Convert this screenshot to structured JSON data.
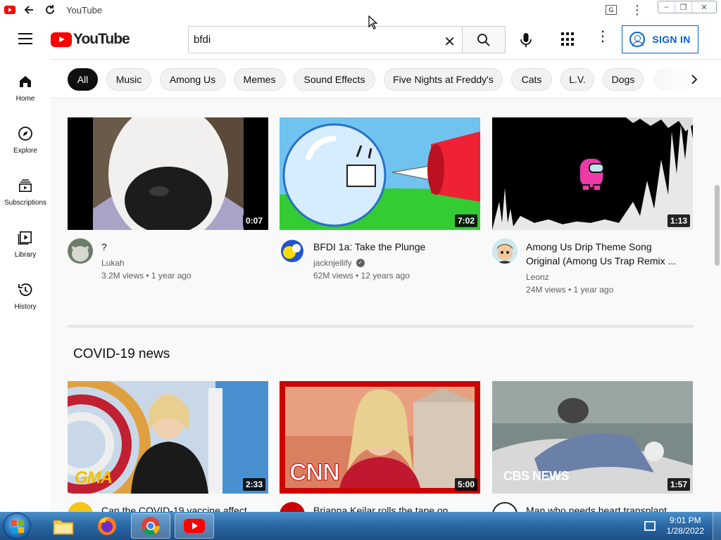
{
  "window": {
    "title": "YouTube"
  },
  "header": {
    "logo_text": "YouTube",
    "search_value": "bfdi",
    "search_placeholder": "Search",
    "sign_in_label": "SIGN IN"
  },
  "sidebar": {
    "items": [
      {
        "label": "Home",
        "icon": "home-icon"
      },
      {
        "label": "Explore",
        "icon": "compass-icon"
      },
      {
        "label": "Subscriptions",
        "icon": "subscriptions-icon"
      },
      {
        "label": "Library",
        "icon": "library-icon"
      },
      {
        "label": "History",
        "icon": "history-icon"
      }
    ]
  },
  "chips": [
    {
      "label": "All",
      "active": true
    },
    {
      "label": "Music"
    },
    {
      "label": "Among Us"
    },
    {
      "label": "Memes"
    },
    {
      "label": "Sound Effects"
    },
    {
      "label": "Five Nights at Freddy's"
    },
    {
      "label": "Cats"
    },
    {
      "label": "L.V."
    },
    {
      "label": "Dogs"
    }
  ],
  "videos": [
    {
      "title": "?",
      "channel": "Lukah",
      "meta": "3.2M views • 1 year ago",
      "duration": "0:07",
      "verified": false
    },
    {
      "title": "BFDI 1a: Take the Plunge",
      "channel": "jacknjellify",
      "meta": "62M views • 12 years ago",
      "duration": "7:02",
      "verified": true
    },
    {
      "title": "Among Us Drip Theme Song Original (Among Us Trap Remix ...",
      "channel": "Leonz",
      "meta": "24M views • 1 year ago",
      "duration": "1:13",
      "verified": false
    }
  ],
  "shelf": {
    "title": "COVID-19 news",
    "videos": [
      {
        "title": "Can the COVID-19 vaccine affect",
        "duration": "2:33",
        "logo": "GMA"
      },
      {
        "title": "Brianna Keilar rolls the tape on",
        "duration": "5:00",
        "logo": "CNN"
      },
      {
        "title": "Man who needs heart transplant",
        "duration": "1:57",
        "logo": "CBS NEWS"
      }
    ]
  },
  "taskbar": {
    "time": "9:01 PM",
    "date": "1/28/2022"
  },
  "colors": {
    "brand_red": "#ff0000",
    "link_blue": "#065fd4"
  }
}
